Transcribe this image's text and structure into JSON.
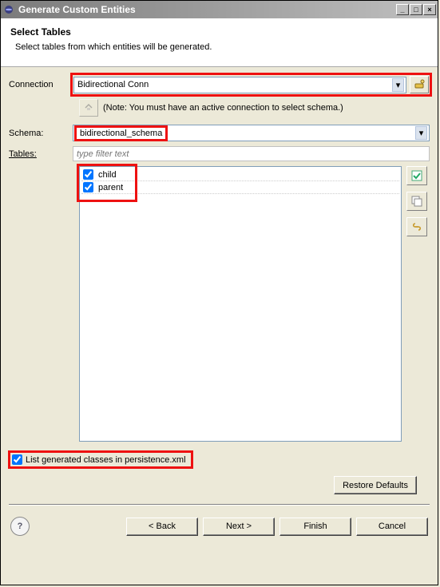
{
  "titlebar": {
    "title": "Generate Custom Entities"
  },
  "header": {
    "title": "Select Tables",
    "subtitle": "Select tables from which entities will be generated."
  },
  "labels": {
    "connection": "Connection",
    "schema": "Schema:",
    "tables": "Tables:"
  },
  "connection": {
    "value": "Bidirectional Conn"
  },
  "note": "(Note: You must have an active connection to select schema.)",
  "schema": {
    "value": "bidirectional_schema"
  },
  "filter": {
    "placeholder": "type filter text"
  },
  "tables": [
    {
      "name": "child",
      "checked": true
    },
    {
      "name": "parent",
      "checked": true
    }
  ],
  "bottom_check": {
    "label": "List generated classes in persistence.xml",
    "checked": true
  },
  "buttons": {
    "restore": "Restore Defaults",
    "back": "< Back",
    "next": "Next >",
    "finish": "Finish",
    "cancel": "Cancel"
  },
  "icons": {
    "eclipse": "◉",
    "conn_new": "⚙",
    "refresh": "↻",
    "selectall": "☑",
    "deselectall": "☐",
    "link": "⛓"
  }
}
